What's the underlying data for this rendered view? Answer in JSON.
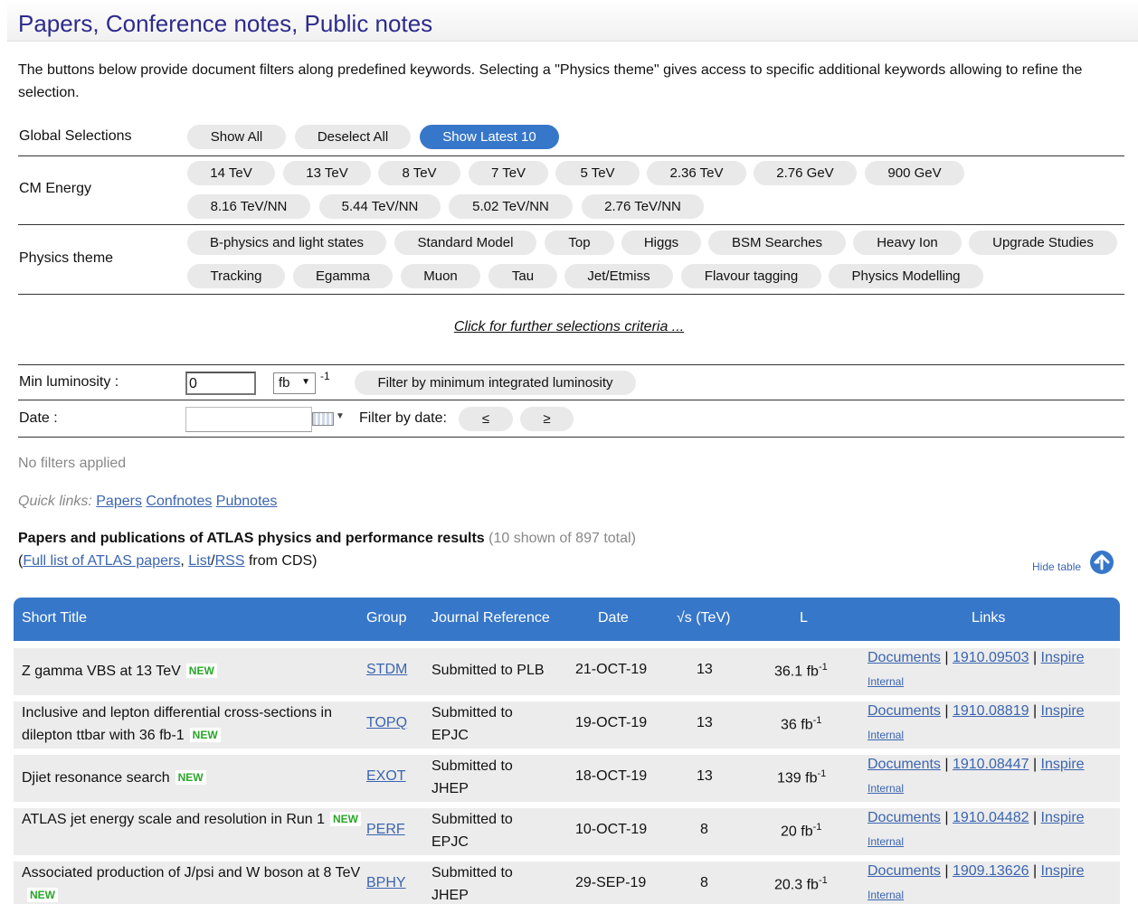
{
  "page_title": "Papers, Conference notes, Public notes",
  "intro": "The buttons below provide document filters along predefined keywords. Selecting a \"Physics theme\" gives access to specific additional keywords allowing to refine the selection.",
  "global": {
    "label": "Global Selections",
    "buttons": [
      "Show All",
      "Deselect All",
      "Show Latest 10"
    ]
  },
  "cm_energy": {
    "label": "CM Energy",
    "row1": [
      "14 TeV",
      "13 TeV",
      "8 TeV",
      "7 TeV",
      "5 TeV",
      "2.36 TeV",
      "2.76 GeV",
      "900 GeV"
    ],
    "row2": [
      "8.16 TeV/NN",
      "5.44 TeV/NN",
      "5.02 TeV/NN",
      "2.76 TeV/NN"
    ]
  },
  "physics": {
    "label": "Physics theme",
    "row1": [
      "B-physics and light states",
      "Standard Model",
      "Top",
      "Higgs",
      "BSM Searches",
      "Heavy Ion",
      "Upgrade Studies"
    ],
    "row2": [
      "Tracking",
      "Egamma",
      "Muon",
      "Tau",
      "Jet/Etmiss",
      "Flavour tagging",
      "Physics Modelling"
    ]
  },
  "further_link": "Click for further selections criteria ...",
  "luminosity": {
    "label": "Min luminosity :",
    "value": "0",
    "unit": "fb",
    "unit_sup": "-1",
    "filter_button": "Filter by minimum integrated luminosity"
  },
  "date_filter": {
    "label": "Date :",
    "value": "",
    "filter_label": "Filter by date:",
    "le": "≤",
    "ge": "≥"
  },
  "status": "No filters applied",
  "quick_links": {
    "label": "Quick links:",
    "links": [
      "Papers",
      "Confnotes",
      "Pubnotes"
    ]
  },
  "results": {
    "heading": "Papers and publications of ATLAS physics and performance results",
    "count": "(10 shown of 897 total)",
    "open_paren": "(",
    "full_list": "Full list of ATLAS papers",
    "comma": ",",
    "list": "List",
    "slash": "/",
    "rss": "RSS",
    "from_cds": "from CDS)",
    "hide_table": "Hide table"
  },
  "table": {
    "headers": [
      "Short Title",
      "Group",
      "Journal Reference",
      "Date",
      "√s (TeV)",
      "L",
      "Links"
    ],
    "rows": [
      {
        "title": "Z gamma VBS at 13 TeV",
        "new": "NEW",
        "group": "STDM",
        "journal": "Submitted to PLB",
        "date": "21-OCT-19",
        "energy": "13",
        "lumi": "36.1 fb",
        "lumi_sup": "-1",
        "documents": "Documents",
        "arxiv": "1910.09503",
        "inspire": "Inspire",
        "internal": "Internal"
      },
      {
        "title": "Inclusive and lepton differential cross-sections in dilepton ttbar with 36 fb-1",
        "new": "NEW",
        "group": "TOPQ",
        "journal": "Submitted to EPJC",
        "date": "19-OCT-19",
        "energy": "13",
        "lumi": "36 fb",
        "lumi_sup": "-1",
        "documents": "Documents",
        "arxiv": "1910.08819",
        "inspire": "Inspire",
        "internal": "Internal"
      },
      {
        "title": "Djiet resonance search",
        "new": "NEW",
        "group": "EXOT",
        "journal": "Submitted to JHEP",
        "date": "18-OCT-19",
        "energy": "13",
        "lumi": "139 fb",
        "lumi_sup": "-1",
        "documents": "Documents",
        "arxiv": "1910.08447",
        "inspire": "Inspire",
        "internal": "Internal"
      },
      {
        "title": "ATLAS jet energy scale and resolution in Run 1",
        "new": "NEW",
        "group": "PERF",
        "journal": "Submitted to EPJC",
        "date": "10-OCT-19",
        "energy": "8",
        "lumi": "20 fb",
        "lumi_sup": "-1",
        "documents": "Documents",
        "arxiv": "1910.04482",
        "inspire": "Inspire",
        "internal": "Internal"
      },
      {
        "title": "Associated production of J/psi and W boson at 8 TeV",
        "new": "NEW",
        "group": "BPHY",
        "journal": "Submitted to JHEP",
        "date": "29-SEP-19",
        "energy": "8",
        "lumi": "20.3 fb",
        "lumi_sup": "-1",
        "documents": "Documents",
        "arxiv": "1909.13626",
        "inspire": "Inspire",
        "internal": "Internal"
      }
    ]
  },
  "colors": {
    "title": "#2d2b8c",
    "accent": "#3777c9",
    "link": "#3b65b0",
    "new": "#2aa52a",
    "row_bg": "#ececec"
  },
  "icons": [
    "up-arrow-circle-icon",
    "calendar-icon",
    "dropdown-arrow-icon"
  ]
}
